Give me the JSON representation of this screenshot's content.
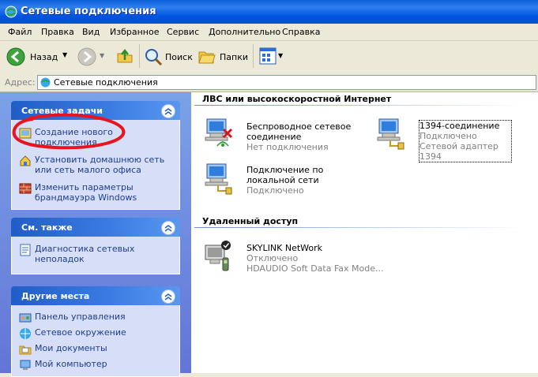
{
  "window": {
    "title": "Сетевые подключения"
  },
  "menu": [
    "Файл",
    "Правка",
    "Вид",
    "Избранное",
    "Сервис",
    "Дополнительно",
    "Справка"
  ],
  "toolbar": {
    "back": "Назад",
    "search": "Поиск",
    "folders": "Папки"
  },
  "address": {
    "label": "Адрес:",
    "value": "Сетевые подключения"
  },
  "left": {
    "network_tasks": {
      "title": "Сетевые задачи",
      "items": [
        "Создание нового подключения",
        "Установить домашнюю сеть или сеть малого офиса",
        "Изменить параметры брандмауэра Windows"
      ]
    },
    "see_also": {
      "title": "См. также",
      "items": [
        "Диагностика сетевых неполадок"
      ]
    },
    "other_places": {
      "title": "Другие места",
      "items": [
        "Панель управления",
        "Сетевое окружение",
        "Мои документы",
        "Мой компьютер"
      ]
    }
  },
  "main": {
    "lan_section": "ЛВС или высокоскоростной Интернет",
    "lan_items": [
      {
        "name": "Беспроводное сетевое соединение",
        "status": "Нет подключения"
      },
      {
        "name": "1394-соединение",
        "status": "Подключено",
        "device": "Сетевой адаптер 1394"
      },
      {
        "name": "Подключение по локальной сети",
        "status": "Подключено"
      }
    ],
    "remote_section": "Удаленный доступ",
    "remote_items": [
      {
        "name": "SKYLINK NetWork",
        "status": "Отключено",
        "device": "HDAUDIO Soft Data Fax Mode..."
      }
    ]
  },
  "colors": {
    "title_bar": "#0a5fd6",
    "task_pane": "#6375d6",
    "link": "#1e3c8c",
    "annotation": "#e8141e"
  }
}
